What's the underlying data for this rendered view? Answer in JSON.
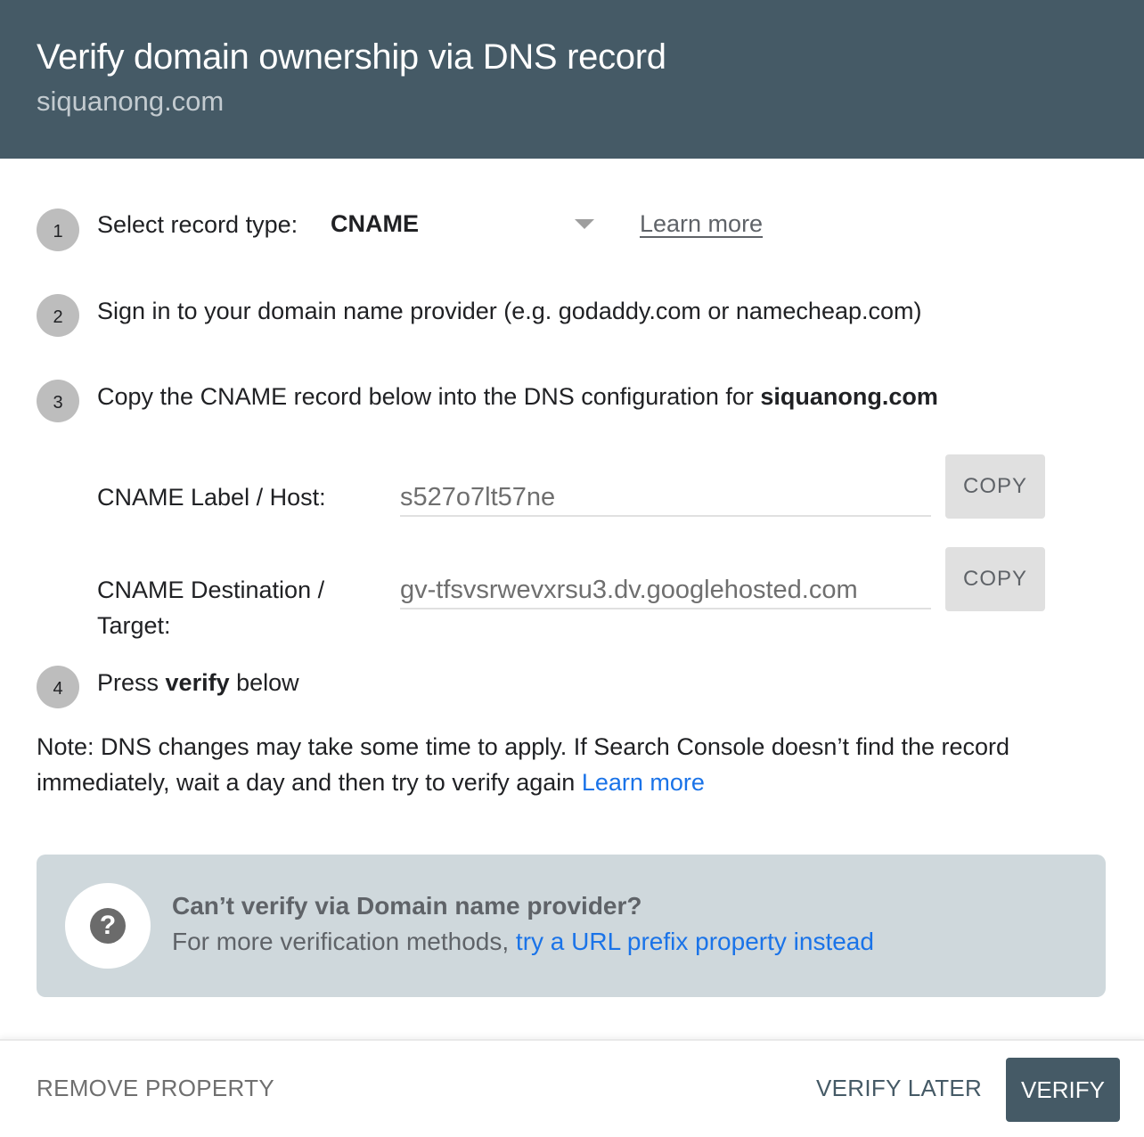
{
  "header": {
    "title": "Verify domain ownership via DNS record",
    "subtitle": "siquanong.com"
  },
  "steps": [
    {
      "number": "1",
      "label": "Select record type:",
      "select_value": "CNAME",
      "learn_more": "Learn more"
    },
    {
      "number": "2",
      "text": "Sign in to your domain name provider (e.g. godaddy.com or namecheap.com)"
    },
    {
      "number": "3",
      "text_prefix": "Copy the CNAME record below into the DNS configuration for ",
      "text_bold": "siquanong.com"
    },
    {
      "number": "4",
      "text_prefix": "Press ",
      "text_bold": "verify",
      "text_suffix": " below"
    }
  ],
  "fields": [
    {
      "label": "CNAME Label / Host:",
      "value": "s527o7lt57ne",
      "copy_label": "COPY"
    },
    {
      "label_line1": "CNAME Destination /",
      "label_line2": "Target:",
      "value": "gv-tfsvsrwevxrsu3.dv.googlehosted.com",
      "copy_label": "COPY"
    }
  ],
  "note": {
    "text": "Note: DNS changes may take some time to apply. If Search Console doesn’t find the record immediately, wait a day and then try to verify again ",
    "link": "Learn more"
  },
  "help": {
    "icon": "question-circle-icon",
    "title": "Can’t verify via Domain name provider?",
    "desc_prefix": "For more verification methods, ",
    "link": "try a URL prefix property instead"
  },
  "footer": {
    "remove_label": "REMOVE PROPERTY",
    "verify_later_label": "VERIFY LATER",
    "verify_label": "VERIFY"
  },
  "colors": {
    "header_bg": "#455a66",
    "link_blue": "#1a73e8",
    "help_bg": "#cfd8dc"
  }
}
